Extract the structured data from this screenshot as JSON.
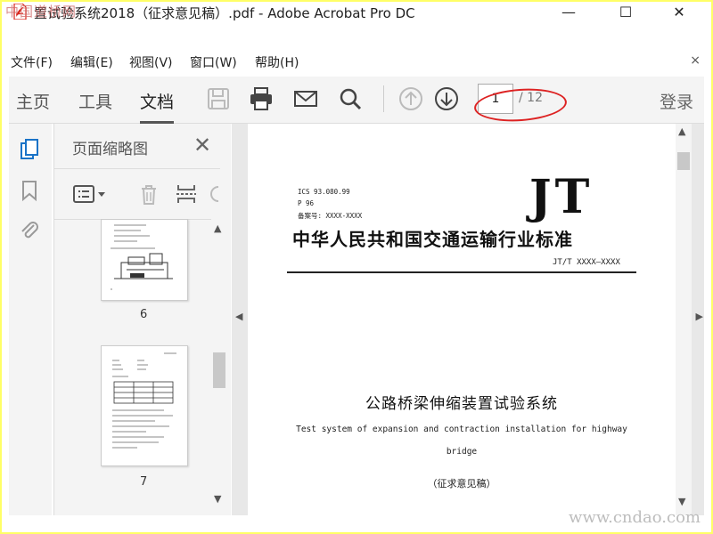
{
  "watermarks": {
    "top": "中国道桥网",
    "bottom": "www.cndao.com"
  },
  "window": {
    "title": "置试验系统2018（征求意见稿）.pdf - Adobe Acrobat Pro DC",
    "minimize": "—",
    "maximize": "☐",
    "close": "✕"
  },
  "menu": {
    "items": [
      "文件(F)",
      "编辑(E)",
      "视图(V)",
      "窗口(W)",
      "帮助(H)"
    ],
    "close_doc": "×"
  },
  "toolbar": {
    "tabs": [
      "主页",
      "工具",
      "文档"
    ],
    "active_tab": "文档",
    "current_page": "1",
    "total_pages": "/ 12",
    "login": "登录",
    "icons": [
      "save-icon",
      "print-icon",
      "mail-icon",
      "search-icon",
      "prev-page-icon",
      "next-page-icon"
    ]
  },
  "left_rail": {
    "icons": [
      "page-thumbnails-icon",
      "bookmark-icon",
      "attachment-icon"
    ]
  },
  "thumbnails": {
    "title": "页面缩略图",
    "close": "✕",
    "pages": [
      {
        "label": "6"
      },
      {
        "label": "7"
      }
    ]
  },
  "document": {
    "meta": [
      "ICS 93.080.99",
      "P 96",
      "备案号: XXXX-XXXX"
    ],
    "logo": "JT",
    "header": "中华人民共和国交通运输行业标准",
    "code": "JT/T XXXX—XXXX",
    "title": "公路桥梁伸缩装置试验系统",
    "title_en_line1": "Test system of expansion and contraction installation for highway",
    "title_en_line2": "bridge",
    "status": "（征求意见稿）"
  },
  "colors": {
    "highlight_ellipse": "#dd2222",
    "frame_border": "#ffff66",
    "pdf_icon": "#d9261c"
  }
}
